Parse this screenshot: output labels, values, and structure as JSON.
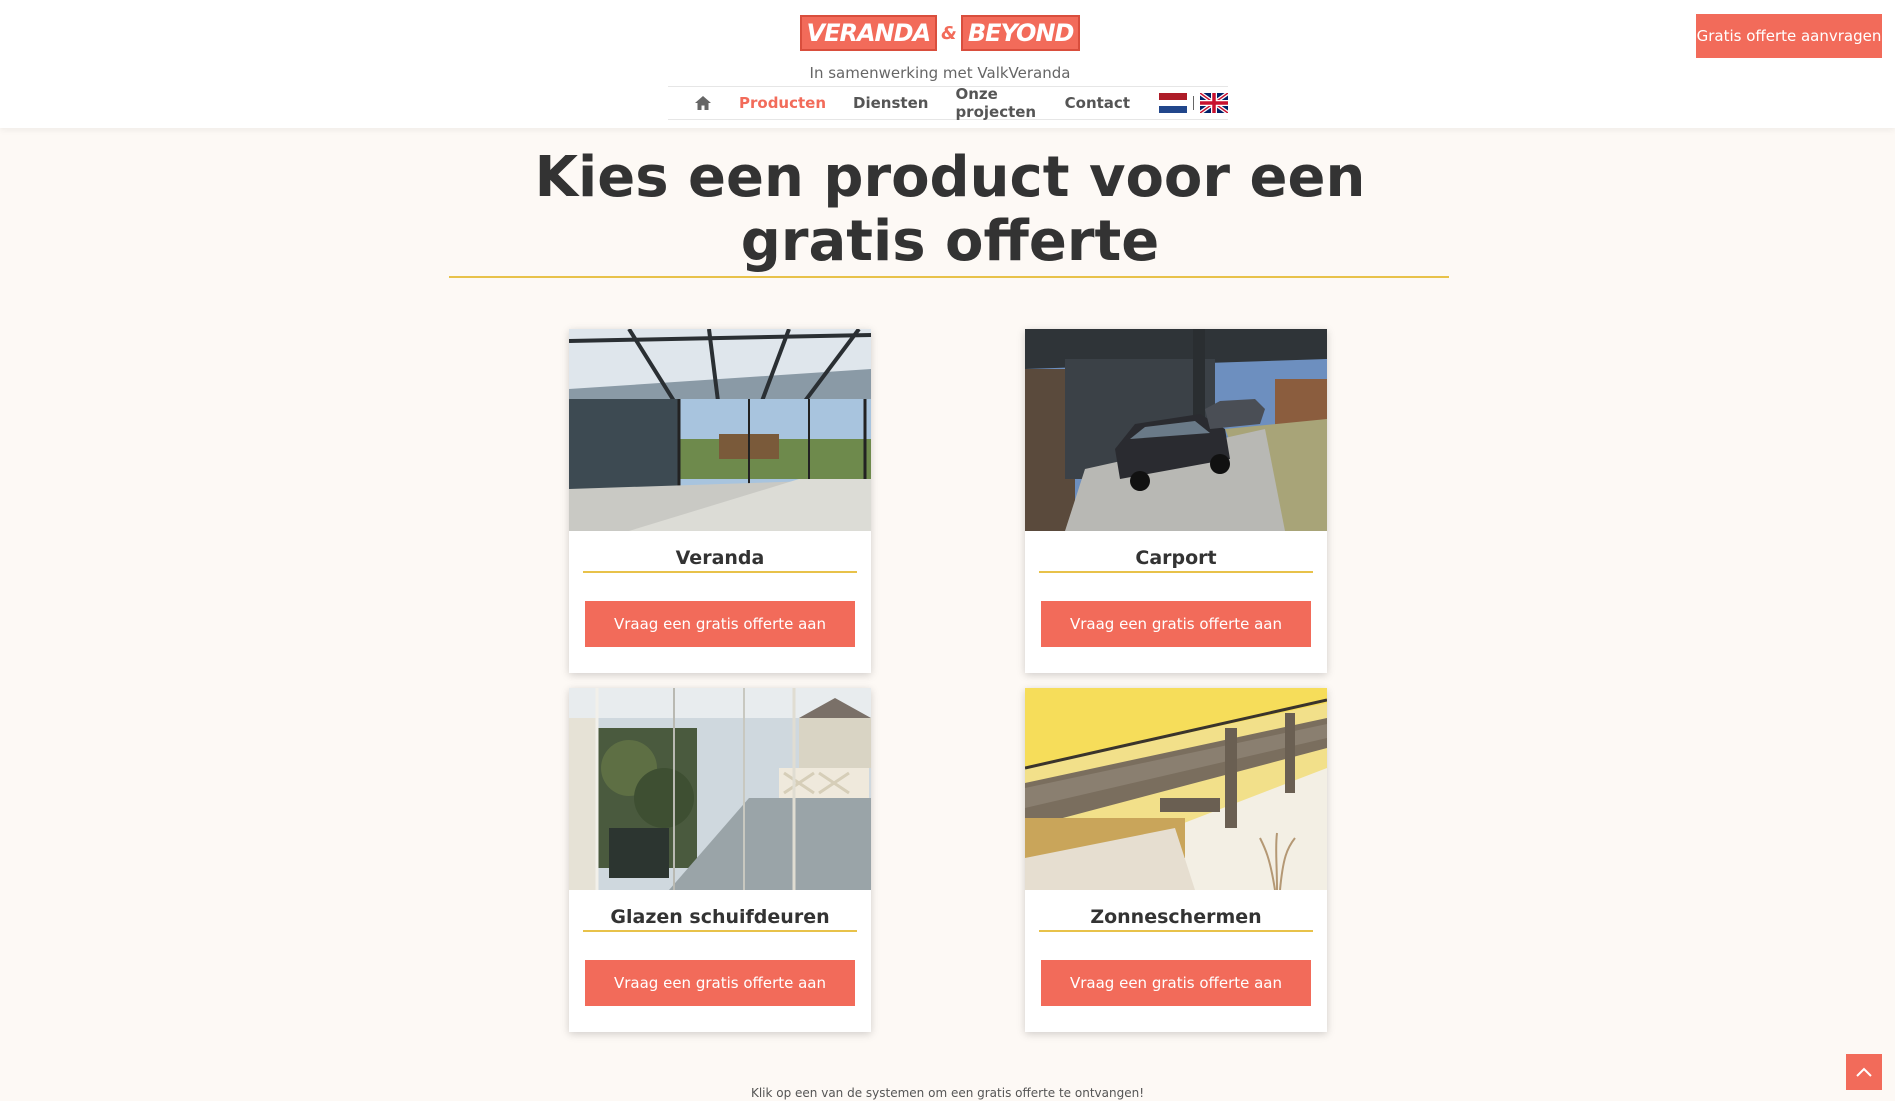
{
  "brand": {
    "logo_part1": "VERANDA",
    "logo_amp": "&",
    "logo_part2": "BEYOND",
    "tagline": "In samenwerking met ValkVeranda",
    "accent_color": "#f26b5a",
    "underline_color": "#e8c24a"
  },
  "nav": {
    "home_icon": "home-icon",
    "items": [
      {
        "label": "Producten",
        "active": true
      },
      {
        "label": "Diensten",
        "active": false
      },
      {
        "label": "Onze projecten",
        "active": false
      },
      {
        "label": "Contact",
        "active": false
      }
    ],
    "languages": [
      "nl-flag-icon",
      "uk-flag-icon"
    ]
  },
  "header_cta": "Gratis offerte aanvragen",
  "page_title": "Kies een product voor een gratis offerte",
  "products": [
    {
      "name": "Veranda",
      "button": "Vraag een gratis offerte aan"
    },
    {
      "name": "Carport",
      "button": "Vraag een gratis offerte aan"
    },
    {
      "name": "Glazen schuifdeuren",
      "button": "Vraag een gratis offerte aan"
    },
    {
      "name": "Zonneschermen",
      "button": "Vraag een gratis offerte aan"
    }
  ],
  "footer_note": "Klik op een van de systemen om een gratis offerte te ontvangen!",
  "scroll_top_icon": "chevron-up-icon"
}
